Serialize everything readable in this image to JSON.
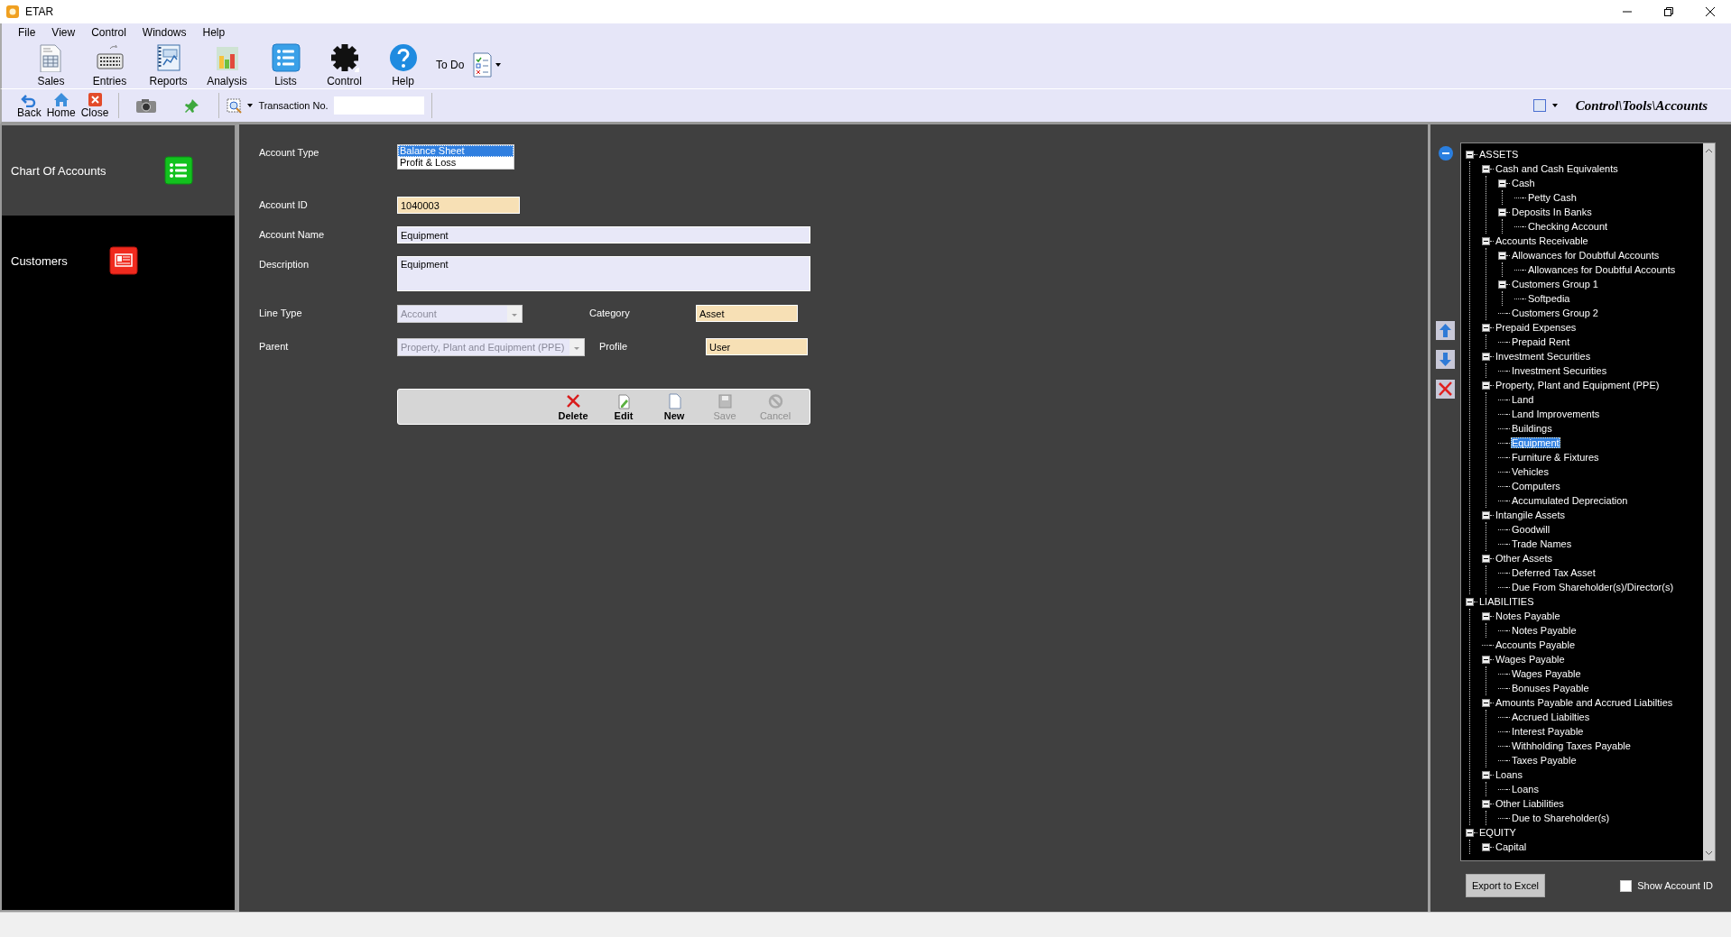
{
  "window": {
    "title": "ETAR"
  },
  "menu": [
    "File",
    "View",
    "Control",
    "Windows",
    "Help"
  ],
  "toolbar": [
    {
      "label": "Sales",
      "kind": "sales"
    },
    {
      "label": "Entries",
      "kind": "entries"
    },
    {
      "label": "Reports",
      "kind": "reports"
    },
    {
      "label": "Analysis",
      "kind": "analysis"
    },
    {
      "label": "Lists",
      "kind": "lists"
    },
    {
      "label": "Control",
      "kind": "control"
    },
    {
      "label": "Help",
      "kind": "help"
    }
  ],
  "todo": {
    "label": "To Do"
  },
  "nav_toolbar": [
    {
      "label": "Back",
      "kind": "back"
    },
    {
      "label": "Home",
      "kind": "home"
    },
    {
      "label": "Close",
      "kind": "close"
    }
  ],
  "transaction": {
    "label": "Transaction No."
  },
  "breadcrumb": "Control\\Tools\\Accounts",
  "sidebar": {
    "items": [
      {
        "label": "Chart Of Accounts",
        "kind": "list",
        "selected": true
      },
      {
        "label": "Customers",
        "kind": "card",
        "selected": false
      }
    ]
  },
  "form": {
    "account_type": {
      "label": "Account Type",
      "options": [
        {
          "label": "Balance Sheet",
          "selected": true
        },
        {
          "label": "Profit & Loss",
          "selected": false
        }
      ]
    },
    "account_id": {
      "label": "Account ID",
      "value": "1040003"
    },
    "account_name": {
      "label": "Account Name",
      "value": "Equipment"
    },
    "description": {
      "label": "Description",
      "value": "Equipment"
    },
    "line_type": {
      "label": "Line Type",
      "value": "Account",
      "disabled": true
    },
    "category": {
      "label": "Category",
      "value": "Asset"
    },
    "parent": {
      "label": "Parent",
      "value": "Property, Plant and Equipment (PPE)",
      "disabled": true
    },
    "profile": {
      "label": "Profile",
      "value": "User"
    },
    "actions": [
      {
        "label": "Delete",
        "kind": "delete",
        "disabled": false
      },
      {
        "label": "Edit",
        "kind": "edit",
        "disabled": false
      },
      {
        "label": "New",
        "kind": "new",
        "disabled": false
      },
      {
        "label": "Save",
        "kind": "save",
        "disabled": true
      },
      {
        "label": "Cancel",
        "kind": "cancel",
        "disabled": true
      }
    ]
  },
  "tree": {
    "items": [
      {
        "label": "ASSETS",
        "selected": false,
        "expanded": true,
        "children": [
          {
            "label": "Cash and Cash Equivalents",
            "selected": false,
            "expanded": true,
            "children": [
              {
                "label": "Cash",
                "selected": false,
                "expanded": true,
                "children": [
                  {
                    "label": "Petty Cash",
                    "selected": false
                  }
                ]
              },
              {
                "label": "Deposits  In Banks",
                "selected": false,
                "expanded": true,
                "children": [
                  {
                    "label": "Checking Account",
                    "selected": false
                  }
                ]
              }
            ]
          },
          {
            "label": "Accounts Receivable",
            "selected": false,
            "expanded": true,
            "children": [
              {
                "label": "Allowances for Doubtful Accounts",
                "selected": false,
                "expanded": true,
                "children": [
                  {
                    "label": "Allowances for Doubtful Accounts",
                    "selected": false
                  }
                ]
              },
              {
                "label": "Customers Group 1",
                "selected": false,
                "expanded": true,
                "children": [
                  {
                    "label": "Softpedia",
                    "selected": false
                  }
                ]
              },
              {
                "label": "Customers Group 2",
                "selected": false
              }
            ]
          },
          {
            "label": "Prepaid Expenses",
            "selected": false,
            "expanded": true,
            "children": [
              {
                "label": "Prepaid Rent",
                "selected": false
              }
            ]
          },
          {
            "label": "Investment Securities",
            "selected": false,
            "expanded": true,
            "children": [
              {
                "label": "Investment Securities",
                "selected": false
              }
            ]
          },
          {
            "label": "Property, Plant and Equipment (PPE)",
            "selected": false,
            "expanded": true,
            "children": [
              {
                "label": "Land",
                "selected": false
              },
              {
                "label": "Land Improvements",
                "selected": false
              },
              {
                "label": "Buildings",
                "selected": false
              },
              {
                "label": "Equipment",
                "selected": true
              },
              {
                "label": "Furniture & Fixtures",
                "selected": false
              },
              {
                "label": "Vehicles",
                "selected": false
              },
              {
                "label": "Computers",
                "selected": false
              },
              {
                "label": "Accumulated Depreciation",
                "selected": false
              }
            ]
          },
          {
            "label": "Intangile Assets",
            "selected": false,
            "expanded": true,
            "children": [
              {
                "label": "Goodwill",
                "selected": false
              },
              {
                "label": "Trade Names",
                "selected": false
              }
            ]
          },
          {
            "label": "Other Assets",
            "selected": false,
            "expanded": true,
            "children": [
              {
                "label": "Deferred Tax Asset",
                "selected": false
              },
              {
                "label": "Due From Shareholder(s)/Director(s)",
                "selected": false
              }
            ]
          }
        ]
      },
      {
        "label": "LIABILITIES",
        "selected": false,
        "expanded": true,
        "children": [
          {
            "label": "Notes Payable",
            "selected": false,
            "expanded": true,
            "children": [
              {
                "label": "Notes Payable",
                "selected": false
              }
            ]
          },
          {
            "label": "Accounts Payable",
            "selected": false
          },
          {
            "label": "Wages Payable",
            "selected": false,
            "expanded": true,
            "children": [
              {
                "label": "Wages Payable",
                "selected": false
              },
              {
                "label": "Bonuses Payable",
                "selected": false
              }
            ]
          },
          {
            "label": "Amounts Payable and Accrued Liabilties",
            "selected": false,
            "expanded": true,
            "children": [
              {
                "label": "Accrued Liabilties",
                "selected": false
              },
              {
                "label": "Interest Payable",
                "selected": false
              },
              {
                "label": "Withholding Taxes Payable",
                "selected": false
              },
              {
                "label": "Taxes Payable",
                "selected": false
              }
            ]
          },
          {
            "label": "Loans",
            "selected": false,
            "expanded": true,
            "children": [
              {
                "label": "Loans",
                "selected": false
              }
            ]
          },
          {
            "label": "Other Liabilities",
            "selected": false,
            "expanded": true,
            "children": [
              {
                "label": "Due to Shareholder(s)",
                "selected": false
              }
            ]
          }
        ]
      },
      {
        "label": "EQUITY",
        "selected": false,
        "expanded": true,
        "children": [
          {
            "label": "Capital",
            "selected": false,
            "expanded": true
          }
        ]
      }
    ]
  },
  "export_button": "Export to Excel",
  "show_account_id": {
    "label": "Show Account ID",
    "checked": false
  }
}
